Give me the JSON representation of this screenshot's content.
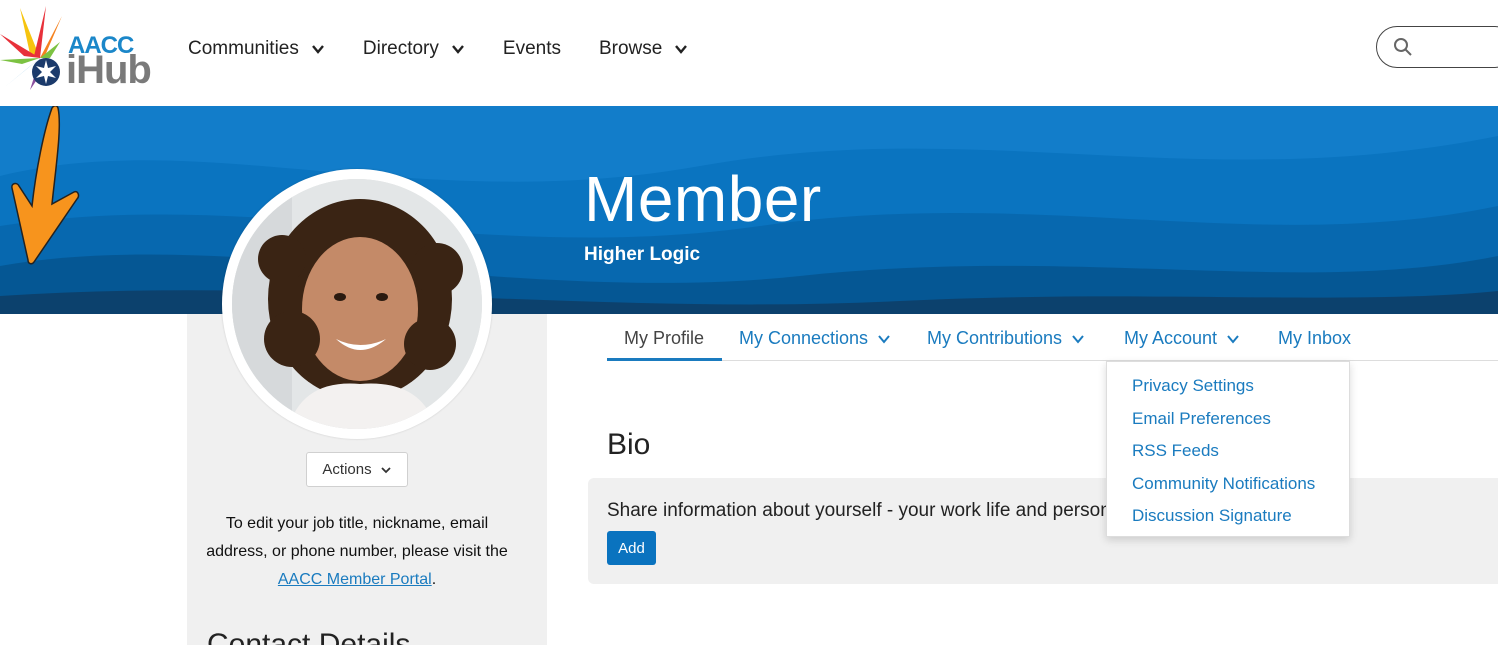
{
  "logo": {
    "line1": "AACC",
    "line2": "iHub"
  },
  "nav": {
    "items": [
      {
        "label": "Communities",
        "has_dropdown": true
      },
      {
        "label": "Directory",
        "has_dropdown": true
      },
      {
        "label": "Events",
        "has_dropdown": false
      },
      {
        "label": "Browse",
        "has_dropdown": true
      }
    ],
    "search_icon": "search-icon"
  },
  "banner": {
    "title": "Member",
    "subtitle": "Higher Logic",
    "annotation_arrow_color": "#f7941d"
  },
  "profile": {
    "actions_label": "Actions",
    "edit_note_prefix": "To edit your job title, nickname, email address, or phone number, please visit the ",
    "edit_note_link": "AACC Member Portal",
    "edit_note_suffix": ".",
    "contact_heading": "Contact Details"
  },
  "tabs": [
    {
      "label": "My Profile",
      "active": true
    },
    {
      "label": "My Connections",
      "has_dropdown": true
    },
    {
      "label": "My Contributions",
      "has_dropdown": true
    },
    {
      "label": "My Account",
      "has_dropdown": true
    },
    {
      "label": "My Inbox"
    }
  ],
  "account_menu": [
    "Privacy Settings",
    "Email Preferences",
    "RSS Feeds",
    "Community Notifications",
    "Discussion Signature"
  ],
  "bio": {
    "heading": "Bio",
    "prompt": "Share information about yourself - your work life and personal interests.",
    "add_label": "Add"
  },
  "colors": {
    "brand_blue": "#0a73bf",
    "link_blue": "#1a7bbf",
    "panel_gray": "#f0f0f0",
    "arrow_orange": "#f7941d"
  }
}
